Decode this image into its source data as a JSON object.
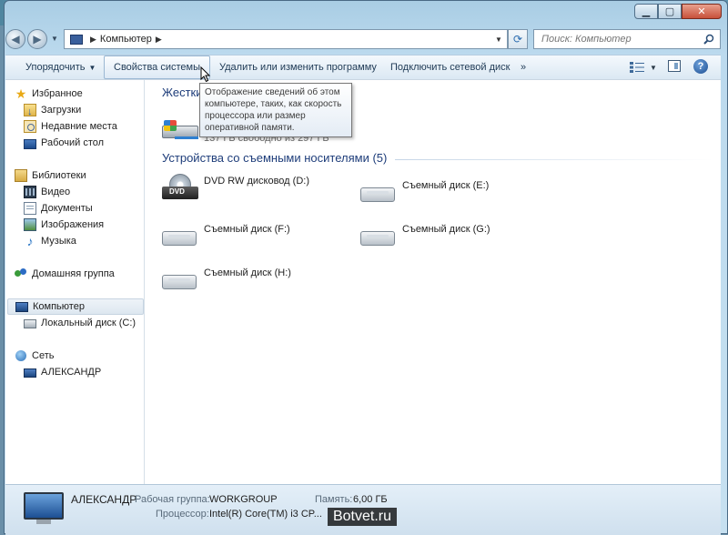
{
  "addressbar": {
    "crumb": "Компьютер"
  },
  "search": {
    "placeholder": "Поиск: Компьютер"
  },
  "toolbar": {
    "organize": "Упорядочить",
    "system_properties": "Свойства системы",
    "uninstall": "Удалить или изменить программу",
    "map_drive": "Подключить сетевой диск",
    "more": "»",
    "help": "?"
  },
  "tooltip": {
    "text": "Отображение сведений об этом компьютере, таких, как скорость процессора или размер оперативной памяти."
  },
  "sidebar": {
    "favorites": "Избранное",
    "downloads": "Загрузки",
    "recent": "Недавние места",
    "desktop": "Рабочий стол",
    "libraries": "Библиотеки",
    "video": "Видео",
    "documents": "Документы",
    "images": "Изображения",
    "music": "Музыка",
    "homegroup": "Домашняя группа",
    "computer": "Компьютер",
    "local_disk": "Локальный диск (C:)",
    "network": "Сеть",
    "network_pc": "АЛЕКСАНДР"
  },
  "main": {
    "hdd_group": "Жестки",
    "hdd_free": "137 ГБ свободно из 297 ГБ",
    "removable_group": "Устройства со съемными носителями (5)",
    "drives": [
      {
        "label": "DVD RW дисковод (D:)"
      },
      {
        "label": "Съемный диск (E:)"
      },
      {
        "label": "Съемный диск (F:)"
      },
      {
        "label": "Съемный диск (G:)"
      },
      {
        "label": "Съемный диск (H:)"
      }
    ]
  },
  "details": {
    "name": "АЛЕКСАНДР",
    "workgroup_label": "Рабочая группа:",
    "workgroup_value": "WORKGROUP",
    "memory_label": "Память:",
    "memory_value": "6,00 ГБ",
    "cpu_label": "Процессор:",
    "cpu_value": "Intel(R) Core(TM) i3 CP..."
  },
  "watermark": "Botvet.ru"
}
